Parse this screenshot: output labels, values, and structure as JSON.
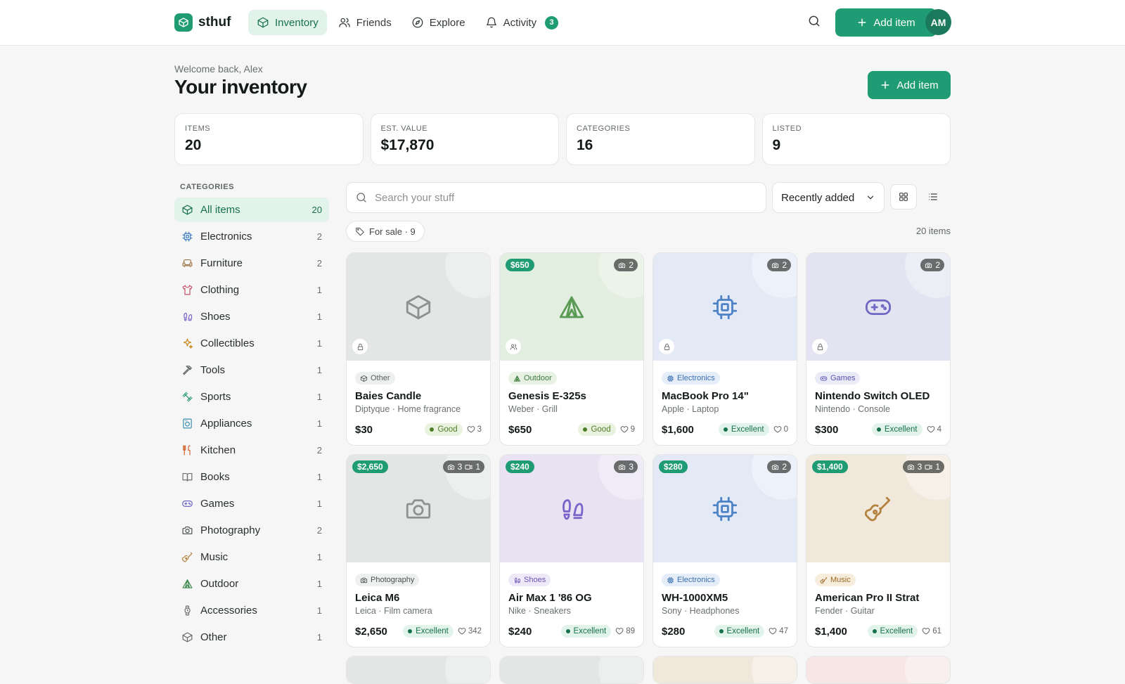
{
  "app": {
    "name": "sthuf"
  },
  "nav": [
    {
      "label": "Inventory",
      "icon": "box-icon",
      "active": true
    },
    {
      "label": "Friends",
      "icon": "users-icon"
    },
    {
      "label": "Explore",
      "icon": "compass-icon"
    },
    {
      "label": "Activity",
      "icon": "bell-icon",
      "badge": "3"
    }
  ],
  "top": {
    "add_label": "Add item",
    "avatar": "AM"
  },
  "header": {
    "welcome": "Welcome back, Alex",
    "title": "Your inventory",
    "add_label": "Add item"
  },
  "stats": [
    {
      "label": "ITEMS",
      "value": "20"
    },
    {
      "label": "EST. VALUE",
      "value": "$17,870"
    },
    {
      "label": "CATEGORIES",
      "value": "16"
    },
    {
      "label": "LISTED",
      "value": "9"
    }
  ],
  "sidebar": {
    "title": "CATEGORIES",
    "items": [
      {
        "label": "All items",
        "count": "20",
        "icon": "box",
        "color": "#17704f",
        "active": true
      },
      {
        "label": "Electronics",
        "count": "2",
        "icon": "chip",
        "color": "#3f7fc4"
      },
      {
        "label": "Furniture",
        "count": "2",
        "icon": "sofa",
        "color": "#a0764a"
      },
      {
        "label": "Clothing",
        "count": "1",
        "icon": "shirt",
        "color": "#c4506a"
      },
      {
        "label": "Shoes",
        "count": "1",
        "icon": "footprints",
        "color": "#7a63c9"
      },
      {
        "label": "Collectibles",
        "count": "1",
        "icon": "sparkles",
        "color": "#c98a1d"
      },
      {
        "label": "Tools",
        "count": "1",
        "icon": "hammer",
        "color": "#5b615e"
      },
      {
        "label": "Sports",
        "count": "1",
        "icon": "dumbbell",
        "color": "#2e9a78"
      },
      {
        "label": "Appliances",
        "count": "1",
        "icon": "washer",
        "color": "#3d8fb0"
      },
      {
        "label": "Kitchen",
        "count": "2",
        "icon": "utensils",
        "color": "#d0642f"
      },
      {
        "label": "Books",
        "count": "1",
        "icon": "book",
        "color": "#6b6f6d"
      },
      {
        "label": "Games",
        "count": "1",
        "icon": "gamepad",
        "color": "#6e67c4"
      },
      {
        "label": "Photography",
        "count": "2",
        "icon": "camera",
        "color": "#4a4f4d"
      },
      {
        "label": "Music",
        "count": "1",
        "icon": "guitar",
        "color": "#b3823e"
      },
      {
        "label": "Outdoor",
        "count": "1",
        "icon": "tent",
        "color": "#3f8a4f"
      },
      {
        "label": "Accessories",
        "count": "1",
        "icon": "watch",
        "color": "#6a6e6c"
      },
      {
        "label": "Other",
        "count": "1",
        "icon": "box",
        "color": "#6a6e6c"
      }
    ]
  },
  "toolbar": {
    "search_placeholder": "Search your stuff",
    "sort_value": "Recently added",
    "filter_chip": "For sale · 9",
    "item_count": "20 items"
  },
  "items": [
    {
      "name": "Baies Candle",
      "sub": "Diptyque · Home fragrance",
      "price": "$30",
      "condition": "Good",
      "likes": "3",
      "category": "Other",
      "icon": "box",
      "tag": "",
      "photos": "",
      "videos": "",
      "visibility": "lock-icon",
      "bg": "#e4e5e5",
      "fg": "#8d918f",
      "pill_bg": "#eeefef",
      "pill_fg": "#5a5f5c"
    },
    {
      "name": "Genesis E-325s",
      "sub": "Weber · Grill",
      "price": "$650",
      "condition": "Good",
      "likes": "9",
      "category": "Outdoor",
      "icon": "tent",
      "tag": "$650",
      "photos": "2",
      "videos": "",
      "visibility": "users-icon",
      "bg": "#e2eedf",
      "fg": "#5a9a55",
      "pill_bg": "#e7f2e4",
      "pill_fg": "#3f7b3c"
    },
    {
      "name": "MacBook Pro 14\"",
      "sub": "Apple · Laptop",
      "price": "$1,600",
      "condition": "Excellent",
      "likes": "0",
      "category": "Electronics",
      "icon": "chip",
      "tag": "",
      "photos": "2",
      "videos": "",
      "visibility": "lock-icon",
      "bg": "#e3eaf6",
      "fg": "#4d82c6",
      "pill_bg": "#e5edf8",
      "pill_fg": "#3a6fb0"
    },
    {
      "name": "Nintendo Switch OLED",
      "sub": "Nintendo · Console",
      "price": "$300",
      "condition": "Excellent",
      "likes": "4",
      "category": "Games",
      "icon": "gamepad",
      "tag": "",
      "photos": "2",
      "videos": "",
      "visibility": "lock-icon",
      "bg": "#e3e3f2",
      "fg": "#6e67c4",
      "pill_bg": "#ebeaf7",
      "pill_fg": "#5a53b2"
    },
    {
      "name": "Leica M6",
      "sub": "Leica · Film camera",
      "price": "$2,650",
      "condition": "Excellent",
      "likes": "342",
      "category": "Photography",
      "icon": "camera",
      "tag": "$2,650",
      "photos": "3",
      "videos": "1",
      "visibility": "",
      "bg": "#e4e5e5",
      "fg": "#8d918f",
      "pill_bg": "#eeefef",
      "pill_fg": "#4a4f4d"
    },
    {
      "name": "Air Max 1 '86 OG",
      "sub": "Nike · Sneakers",
      "price": "$240",
      "condition": "Excellent",
      "likes": "89",
      "category": "Shoes",
      "icon": "footprints",
      "tag": "$240",
      "photos": "3",
      "videos": "",
      "visibility": "",
      "bg": "#e8e2f3",
      "fg": "#7a63c9",
      "pill_bg": "#eee9f8",
      "pill_fg": "#6a53b8"
    },
    {
      "name": "WH-1000XM5",
      "sub": "Sony · Headphones",
      "price": "$280",
      "condition": "Excellent",
      "likes": "47",
      "category": "Electronics",
      "icon": "chip",
      "tag": "$280",
      "photos": "2",
      "videos": "",
      "visibility": "",
      "bg": "#e3eaf6",
      "fg": "#4d82c6",
      "pill_bg": "#e5edf8",
      "pill_fg": "#3a6fb0"
    },
    {
      "name": "American Pro II Strat",
      "sub": "Fender · Guitar",
      "price": "$1,400",
      "condition": "Excellent",
      "likes": "61",
      "category": "Music",
      "icon": "guitar",
      "tag": "$1,400",
      "photos": "3",
      "videos": "1",
      "visibility": "",
      "bg": "#f1e8dc",
      "fg": "#b3823e",
      "pill_bg": "#f6eddd",
      "pill_fg": "#9a6a25"
    }
  ],
  "peek_colors": [
    "#e4e5e5",
    "#e4e5e5",
    "#f1e8dc",
    "#f8e6e6"
  ],
  "condition_colors": {
    "Good": {
      "bg": "#e9f2df",
      "fg": "#4f7c26"
    },
    "Excellent": {
      "bg": "#e2f3eb",
      "fg": "#17704f"
    }
  }
}
